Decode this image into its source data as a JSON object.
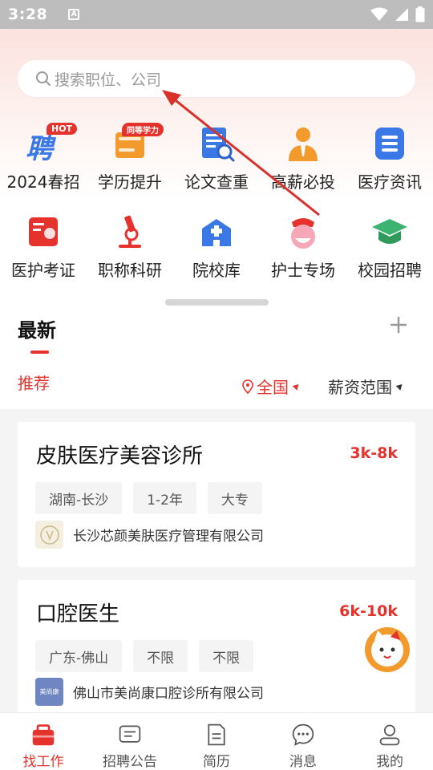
{
  "status_bar": {
    "time": "3:28",
    "a_label": "A"
  },
  "search": {
    "placeholder": "搜索职位、公司"
  },
  "grid_row1": [
    {
      "label": "2024春招",
      "badge": "HOT",
      "icon": "spring-recruit-icon"
    },
    {
      "label": "学历提升",
      "badge": "同等学力",
      "icon": "education-book-icon"
    },
    {
      "label": "论文查重",
      "badge": "",
      "icon": "paper-check-icon"
    },
    {
      "label": "高薪必投",
      "badge": "",
      "icon": "high-salary-person-icon"
    },
    {
      "label": "医疗资讯",
      "badge": "",
      "icon": "medical-news-icon"
    }
  ],
  "grid_row2": [
    {
      "label": "医护考证",
      "icon": "certificate-icon"
    },
    {
      "label": "职称科研",
      "icon": "microscope-icon"
    },
    {
      "label": "院校库",
      "icon": "hospital-icon"
    },
    {
      "label": "护士专场",
      "icon": "nurse-icon"
    },
    {
      "label": "校园招聘",
      "icon": "graduation-cap-icon"
    }
  ],
  "section": {
    "tab_latest": "最新"
  },
  "filters": {
    "recommend": "推荐",
    "region": "全国",
    "salary": "薪资范围"
  },
  "jobs": [
    {
      "title": "皮肤医疗美容诊所",
      "salary": "3k-8k",
      "tags": [
        "湖南-长沙",
        "1-2年",
        "大专"
      ],
      "company": "长沙芯颜美肤医疗管理有限公司"
    },
    {
      "title": "口腔医生",
      "salary": "6k-10k",
      "tags": [
        "广东-佛山",
        "不限",
        "不限"
      ],
      "company": "佛山市美尚康口腔诊所有限公司",
      "logo_text": "美尚康"
    }
  ],
  "bottom_nav": [
    {
      "label": "找工作",
      "icon": "briefcase-icon",
      "active": true
    },
    {
      "label": "招聘公告",
      "icon": "announcement-icon"
    },
    {
      "label": "简历",
      "icon": "resume-icon"
    },
    {
      "label": "消息",
      "icon": "message-icon"
    },
    {
      "label": "我的",
      "icon": "profile-icon"
    }
  ],
  "colors": {
    "accent": "#e5322d",
    "blue": "#3a78e6",
    "orange": "#f39a2c",
    "green": "#3cb371"
  }
}
